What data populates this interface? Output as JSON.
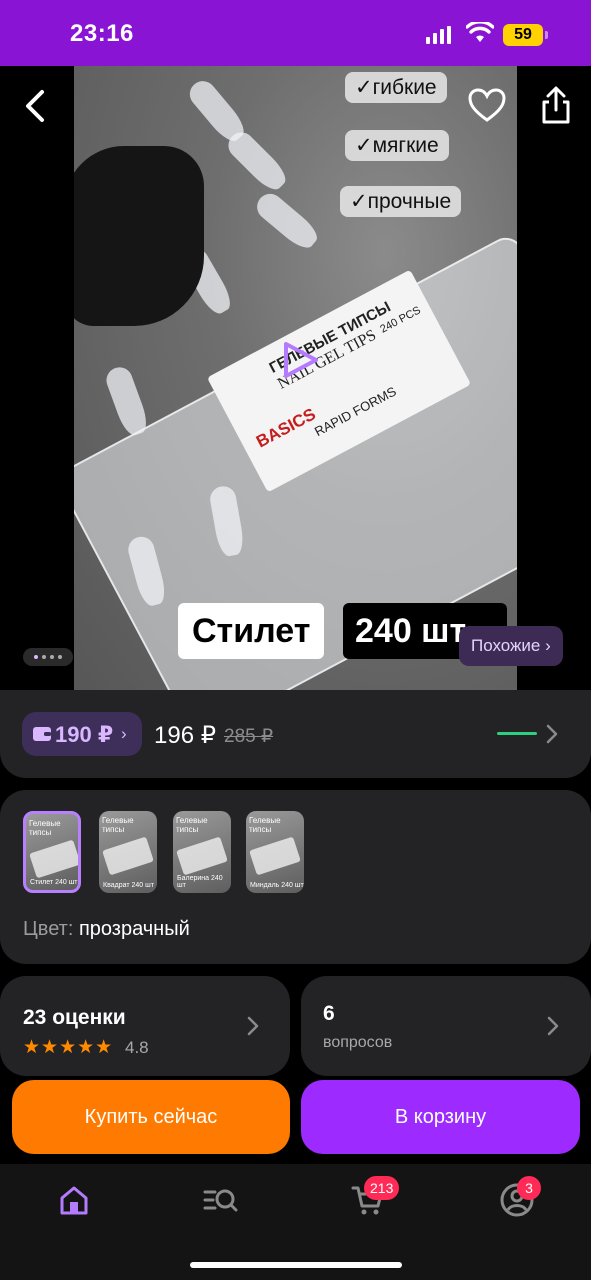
{
  "status_bar": {
    "time": "23:16",
    "battery": "59"
  },
  "media": {
    "features": [
      "✓гибкие",
      "✓мягкие",
      "✓прочные"
    ],
    "label_lines": [
      "ГЕЛЕВЫЕ ТИПСЫ",
      "NAIL GEL TIPS",
      "BASICS",
      "RAPID FORMS",
      "240 PCS"
    ],
    "shape": "Стилет",
    "count": "240 шт",
    "similar": "Похожие ›"
  },
  "price": {
    "wallet_price": "190 ₽",
    "wallet_chevron": "›",
    "current": "196 ₽",
    "old": "285 ₽",
    "accent_color": "#2bd17e"
  },
  "variants": {
    "thumbnails": [
      {
        "title": "Гелевые типсы",
        "caption": "Стилет 240 шт"
      },
      {
        "title": "Гелевые типсы",
        "caption": "Квадрат 240 шт"
      },
      {
        "title": "Гелевые типсы",
        "caption": "Балерина 240 шт"
      },
      {
        "title": "Гелевые типсы",
        "caption": "Миндаль 240 шт"
      }
    ],
    "color_label": "Цвет:",
    "color_value": "прозрачный"
  },
  "reviews": {
    "title": "23 оценки",
    "stars": "★★★★★",
    "rating": "4.8"
  },
  "questions": {
    "count": "6",
    "label": "вопросов"
  },
  "actions": {
    "buy_now": "Купить сейчас",
    "add_to_cart": "В корзину"
  },
  "tabbar": {
    "items": [
      "home",
      "catalog",
      "cart",
      "profile"
    ],
    "cart_badge": "213",
    "profile_badge": "3"
  },
  "colors": {
    "brand": "#8a14d4",
    "buy": "#ff7a00",
    "cart": "#9d2bff"
  }
}
